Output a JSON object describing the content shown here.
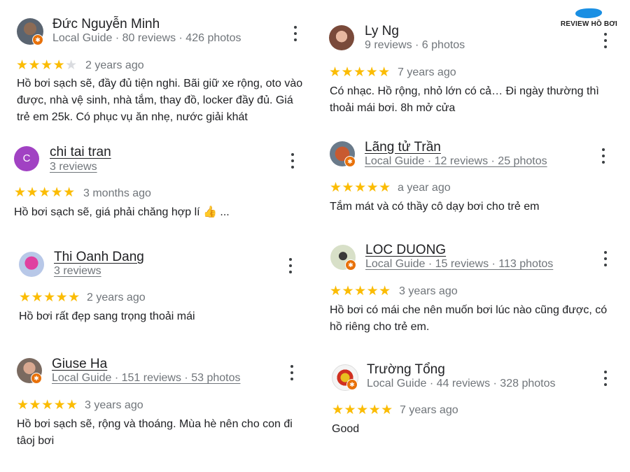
{
  "logo": {
    "text": "REVIEW HỒ BƠI"
  },
  "reviews": [
    {
      "name": "Đức Nguyễn Minh",
      "meta": "Local Guide · 80 reviews · 426 photos",
      "stars": 4,
      "time": "2 years ago",
      "text": "Hồ bơi sạch sẽ, đầy đủ tiện nghi. Bãi giữ xe rộng, oto vào được, nhà vệ sinh, nhà tắm, thay đồ, locker đầy đủ. Giá trẻ em 25k. Có phục vụ ăn nhẹ, nước giải khát"
    },
    {
      "name": "chi tai tran",
      "meta": "3 reviews",
      "avatar_letter": "C",
      "stars": 5,
      "time": "3 months ago",
      "text": "Hồ bơi sạch sẽ, giá phải chăng hợp lí 👍 ..."
    },
    {
      "name": "Thi Oanh Dang",
      "meta": "3 reviews",
      "stars": 5,
      "time": "2 years ago",
      "text": "Hồ bơi rất đẹp sang trọng thoải mái"
    },
    {
      "name": "Giuse Ha",
      "meta": "Local Guide · 151 reviews · 53 photos",
      "stars": 5,
      "time": "3 years ago",
      "text": "Hồ bơi sạch sẽ, rộng và thoáng. Mùa hè nên cho con đi tâoj bơi"
    },
    {
      "name": "Ly Ng",
      "meta": "9 reviews · 6 photos",
      "stars": 5,
      "time": "7 years ago",
      "text": "Có nhạc. Hồ rộng, nhỏ lớn có cả… Đi ngày thường thì thoải mái bơi. 8h mở cửa"
    },
    {
      "name": "Lãng tử Trần",
      "meta": "Local Guide · 12 reviews · 25 photos",
      "stars": 5,
      "time": "a year ago",
      "text": "Tắm mát và có thầy cô dạy bơi cho trẻ em"
    },
    {
      "name": "LOC DUONG",
      "meta": "Local Guide · 15 reviews · 113 photos",
      "stars": 5,
      "time": "3 years ago",
      "text": "Hồ bơi có mái che nên muốn bơi lúc nào cũng được, có hồ riêng cho trẻ em."
    },
    {
      "name": "Trường Tổng",
      "meta": "Local Guide · 44 reviews · 328 photos",
      "stars": 5,
      "time": "7 years ago",
      "text": "Good"
    }
  ],
  "colors": {
    "star": "#fbbc04",
    "star_empty": "#dadce0",
    "badge": "#e8710a",
    "avatar_c": "#a142c3",
    "logo": "#1a8fe3"
  }
}
